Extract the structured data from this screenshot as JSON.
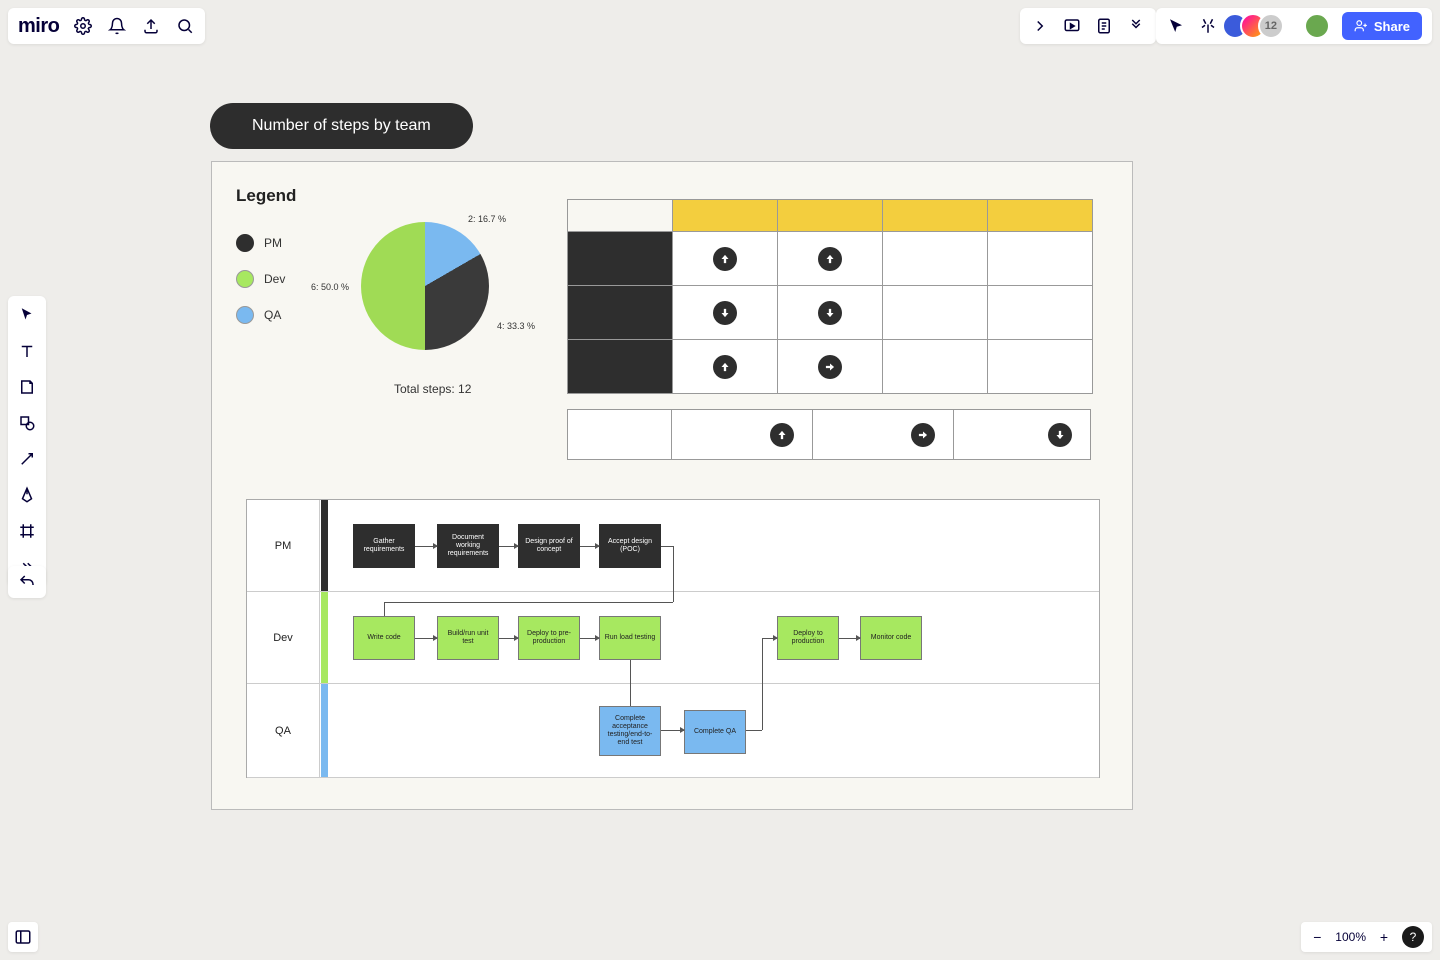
{
  "app": {
    "logo": "miro"
  },
  "header": {
    "avatar_overflow": "12",
    "share_label": "Share"
  },
  "zoom": {
    "level": "100%"
  },
  "frame": {
    "title": "Number of steps by team",
    "legend_title": "Legend",
    "legend": {
      "pm": "PM",
      "dev": "Dev",
      "qa": "QA"
    },
    "pie_labels": {
      "dev": "6: 50.0 %",
      "pm": "4: 33.3 %",
      "qa": "2: 16.7 %"
    },
    "totals": "Total steps: 12"
  },
  "chart_data": {
    "type": "pie",
    "title": "Number of steps by team",
    "series": [
      {
        "name": "PM",
        "value": 4,
        "pct": 33.3,
        "color": "#2e2e2e"
      },
      {
        "name": "Dev",
        "value": 6,
        "pct": 50.0,
        "color": "#a7e860"
      },
      {
        "name": "QA",
        "value": 2,
        "pct": 16.7,
        "color": "#7ab9f0"
      }
    ],
    "total": 12
  },
  "swimlane": {
    "lanes": {
      "pm": "PM",
      "dev": "Dev",
      "qa": "QA"
    },
    "cards": {
      "pm1": "Gather requirements",
      "pm2": "Document working requirements",
      "pm3": "Design proof of concept",
      "pm4": "Accept design (POC)",
      "dev1": "Write code",
      "dev2": "Build/run unit test",
      "dev3": "Deploy to pre-production",
      "dev4": "Run load testing",
      "dev5": "Deploy to production",
      "dev6": "Monitor code",
      "qa1": "Complete acceptance testing/end-to-end test",
      "qa2": "Complete QA"
    }
  }
}
